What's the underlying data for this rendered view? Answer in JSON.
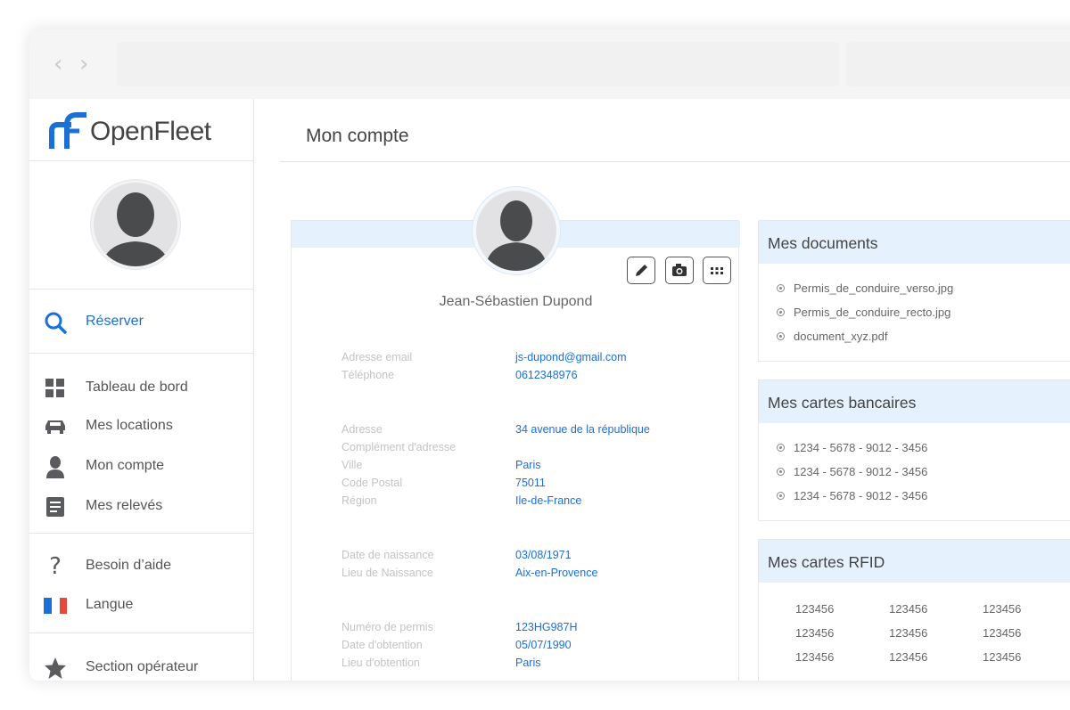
{
  "brand": {
    "name_light": "Open",
    "name_bold": "Fleet",
    "accent": "#1a6fd9"
  },
  "sidebar": {
    "primary": {
      "icon": "search-icon",
      "label": "Réserver"
    },
    "items": [
      {
        "icon": "dashboard-icon",
        "label": "Tableau de bord"
      },
      {
        "icon": "car-icon",
        "label": "Mes locations"
      },
      {
        "icon": "user-icon",
        "label": "Mon compte"
      },
      {
        "icon": "document-icon",
        "label": "Mes relevés"
      }
    ],
    "help": [
      {
        "icon": "question-icon",
        "label": "Besoin d’aide"
      },
      {
        "icon": "french-flag-icon",
        "label": "Langue"
      }
    ],
    "operator": {
      "icon": "star-icon",
      "label": "Section opérateur"
    }
  },
  "header": {
    "title": "Mon compte"
  },
  "profile": {
    "name": "Jean-Sébastien Dupond",
    "tools": [
      "edit-icon",
      "camera-icon",
      "more-icon"
    ],
    "groups": [
      [
        {
          "label": "Adresse email",
          "value": "js-dupond@gmail.com"
        },
        {
          "label": "Téléphone",
          "value": "0612348976"
        }
      ],
      [
        {
          "label": "Adresse",
          "value": "34 avenue de la république"
        },
        {
          "label": "Complément d'adresse",
          "value": ""
        },
        {
          "label": "Ville",
          "value": "Paris"
        },
        {
          "label": "Code Postal",
          "value": "75011"
        },
        {
          "label": "Région",
          "value": "Ile-de-France"
        }
      ],
      [
        {
          "label": "Date de naissance",
          "value": "03/08/1971"
        },
        {
          "label": "Lieu de Naissance",
          "value": "Aix-en-Provence"
        }
      ],
      [
        {
          "label": "Numéro de permis",
          "value": "123HG987H"
        },
        {
          "label": "Date d'obtention",
          "value": "05/07/1990"
        },
        {
          "label": "Lieu d'obtention",
          "value": "Paris"
        }
      ]
    ]
  },
  "documents": {
    "title": "Mes documents",
    "items": [
      "Permis_de_conduire_verso.jpg",
      "Permis_de_conduire_recto.jpg",
      "document_xyz.pdf"
    ]
  },
  "cards": {
    "title": "Mes cartes bancaires",
    "items": [
      "1234 - 5678 - 9012 - 3456",
      "1234 - 5678 - 9012 - 3456",
      "1234 - 5678 - 9012 - 3456"
    ]
  },
  "rfid": {
    "title": "Mes cartes RFID",
    "rows": [
      [
        "123456",
        "123456",
        "123456"
      ],
      [
        "123456",
        "123456",
        "123456"
      ],
      [
        "123456",
        "123456",
        "123456"
      ]
    ]
  }
}
